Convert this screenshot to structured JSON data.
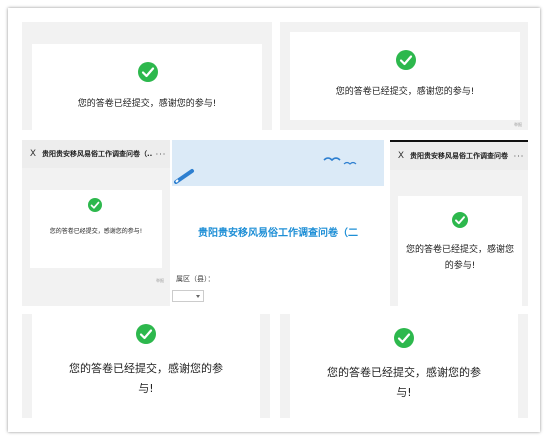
{
  "message": "您的答卷已经提交，感谢您的参与!",
  "message_line1": "您的答卷已经提交，感谢您",
  "message_line2": "的参与!",
  "message_split_a1": "您的答卷已经提交，感谢您的参",
  "message_split_a2": "与!",
  "message_split_b1": "您的答卷已经提交，感谢您的参",
  "message_split_b2": "与!",
  "survey_title": "贵阳贵安移风易俗工作调查问卷（...",
  "form_title": "贵阳贵安移风易俗工作调查问卷（二",
  "district_label": "属区（县）：",
  "close_glyph": "X",
  "more_glyph": "···",
  "footer_small": "举报",
  "colors": {
    "check": "#2db84d",
    "title_blue": "#1f8fd6",
    "banner": "#dbeaf7"
  },
  "icons": [
    "check-circle-icon",
    "close-icon",
    "more-icon",
    "pen-icon",
    "seagull-icon",
    "dropdown-arrow-icon"
  ]
}
